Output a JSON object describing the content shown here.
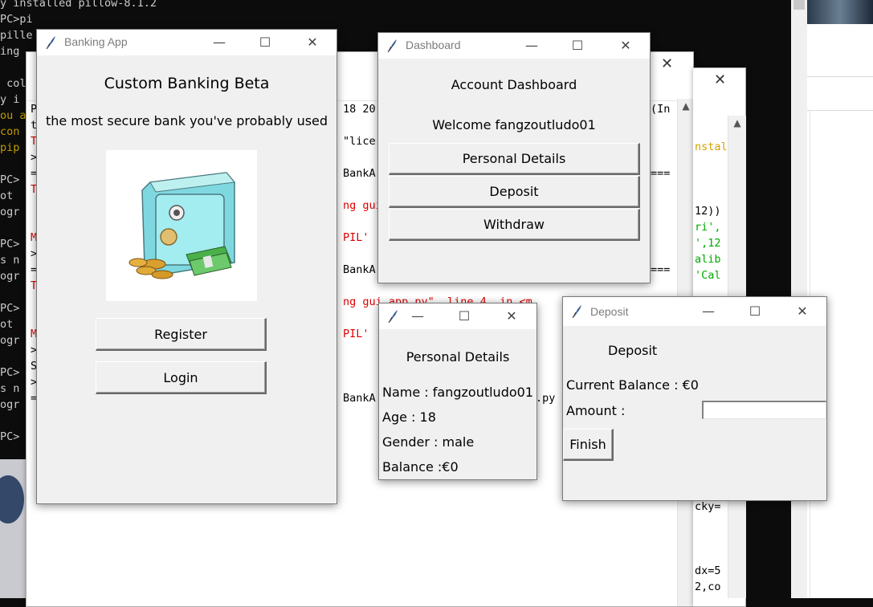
{
  "console": {
    "lines": [
      {
        "text": "y installed pillow-8.1.2",
        "cls": ""
      },
      {
        "text": "PC>pi",
        "cls": ""
      },
      {
        "text": "pille",
        "cls": ""
      },
      {
        "text": "ing",
        "cls": ""
      },
      {
        "text": "",
        "cls": ""
      },
      {
        "text": " col",
        "cls": ""
      },
      {
        "text": "y i",
        "cls": ""
      },
      {
        "text": "ou a",
        "cls": "c-yellow"
      },
      {
        "text": "con",
        "cls": "c-yellow"
      },
      {
        "text": "pip",
        "cls": "c-yellow"
      },
      {
        "text": "",
        "cls": ""
      },
      {
        "text": "PC>",
        "cls": ""
      },
      {
        "text": "ot",
        "cls": ""
      },
      {
        "text": "ogr",
        "cls": ""
      },
      {
        "text": "",
        "cls": ""
      },
      {
        "text": "PC>",
        "cls": ""
      },
      {
        "text": "s n",
        "cls": ""
      },
      {
        "text": "ogr",
        "cls": ""
      },
      {
        "text": "",
        "cls": ""
      },
      {
        "text": "PC>",
        "cls": ""
      },
      {
        "text": "ot",
        "cls": ""
      },
      {
        "text": "ogr",
        "cls": ""
      },
      {
        "text": "",
        "cls": ""
      },
      {
        "text": "PC>",
        "cls": ""
      },
      {
        "text": "s n",
        "cls": ""
      },
      {
        "text": "ogr",
        "cls": ""
      },
      {
        "text": "",
        "cls": ""
      },
      {
        "text": "PC>",
        "cls": ""
      }
    ]
  },
  "editor_back": {
    "close_glyph": "✕",
    "left_col": [
      "P",
      "t",
      "T",
      ">",
      "=",
      "T",
      "",
      "",
      "M",
      ">",
      "=",
      "T",
      "",
      "",
      "M",
      ">",
      "S",
      ">",
      "="
    ],
    "mid_lines": [
      {
        "text": "18 20",
        "cls": ""
      },
      {
        "text": "",
        "cls": ""
      },
      {
        "text": "\"lice",
        "cls": ""
      },
      {
        "text": "",
        "cls": ""
      },
      {
        "text": "BankA",
        "cls": ""
      },
      {
        "text": "",
        "cls": ""
      },
      {
        "text": "ng gui",
        "cls": "red"
      },
      {
        "text": "",
        "cls": ""
      },
      {
        "text": "PIL'",
        "cls": "red"
      },
      {
        "text": "",
        "cls": ""
      },
      {
        "text": "BankA",
        "cls": ""
      },
      {
        "text": "",
        "cls": ""
      },
      {
        "text": "ng gui app.py\", line 4, in <m",
        "cls": "red"
      },
      {
        "text": "",
        "cls": ""
      },
      {
        "text": "PIL'",
        "cls": "red"
      },
      {
        "text": "",
        "cls": ""
      },
      {
        "text": "",
        "cls": ""
      },
      {
        "text": "",
        "cls": ""
      },
      {
        "text": "BankA",
        "cls": ""
      }
    ],
    "right_lines": [
      {
        "text": "(In",
        "cls": ""
      },
      {
        "text": "",
        "cls": ""
      },
      {
        "text": "",
        "cls": ""
      },
      {
        "text": "",
        "cls": ""
      },
      {
        "text": "===",
        "cls": ""
      },
      {
        "text": "",
        "cls": ""
      },
      {
        "text": "",
        "cls": ""
      },
      {
        "text": "",
        "cls": ""
      },
      {
        "text": "",
        "cls": ""
      },
      {
        "text": "",
        "cls": ""
      },
      {
        "text": "===",
        "cls": ""
      }
    ],
    "py_suffix": ".py",
    "scroll_up": "▲"
  },
  "editor_front": {
    "close_glyph": "✕",
    "lines": [
      {
        "text": "nstall",
        "cls": "yel"
      },
      {
        "text": "",
        "cls": ""
      },
      {
        "text": "",
        "cls": ""
      },
      {
        "text": "",
        "cls": ""
      },
      {
        "text": "12))",
        "cls": ""
      },
      {
        "text": "ri',",
        "cls": "green"
      },
      {
        "text": "',12",
        "cls": "green"
      },
      {
        "text": "alib",
        "cls": "green"
      },
      {
        "text": "'Cal",
        "cls": "green"
      }
    ],
    "lower_lines": [
      {
        "text": "cky=",
        "cls": ""
      },
      {
        "text": "",
        "cls": ""
      },
      {
        "text": "",
        "cls": ""
      },
      {
        "text": "",
        "cls": ""
      },
      {
        "text": "dx=5",
        "cls": ""
      },
      {
        "text": "2,co",
        "cls": ""
      }
    ],
    "scroll_up": "▲"
  },
  "banking": {
    "title": "Banking App",
    "heading": "Custom Banking Beta",
    "tagline": "the most secure bank you've probably used",
    "register": "Register",
    "login": "Login"
  },
  "controls": {
    "minimize": "—",
    "maximize": "☐",
    "close": "✕"
  },
  "dashboard": {
    "title": "Dashboard",
    "heading": "Account Dashboard",
    "welcome": "Welcome fangzoutludo01",
    "personal": "Personal Details",
    "deposit": "Deposit",
    "withdraw": "Withdraw"
  },
  "personal": {
    "heading": "Personal Details",
    "name": "Name : fangzoutludo01",
    "age": "Age : 18",
    "gender": "Gender : male",
    "balance": "Balance :€0"
  },
  "deposit": {
    "title": "Deposit",
    "heading": "Deposit",
    "balance": "Current Balance : €0",
    "amount_label": "Amount :",
    "amount_value": "",
    "finish": "Finish"
  }
}
